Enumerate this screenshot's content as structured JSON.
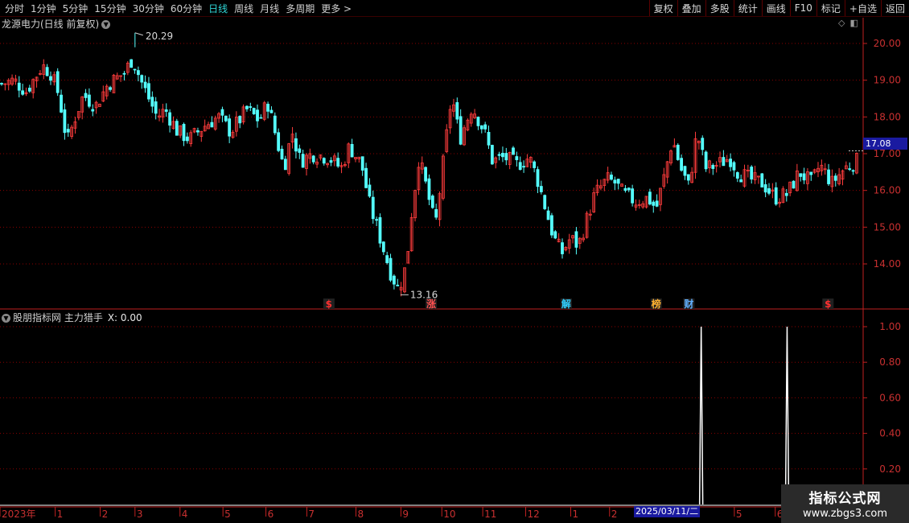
{
  "toolbar": {
    "periods": [
      "分时",
      "1分钟",
      "5分钟",
      "15分钟",
      "30分钟",
      "60分钟",
      "日线",
      "周线",
      "月线",
      "多周期",
      "更多 >"
    ],
    "active_period": "日线",
    "actions": [
      "复权",
      "叠加",
      "多股",
      "统计",
      "画线",
      "F10",
      "标记",
      "+自选",
      "返回"
    ]
  },
  "stock": {
    "title": "龙源电力(日线 前复权)",
    "current_price": "17.08",
    "high_label": "20.29",
    "low_label": "13.16"
  },
  "indicator": {
    "name": "股朋指标网 主力猎手",
    "value_label": "X: 0.00"
  },
  "date_cursor": "2025/03/11/二",
  "watermark": {
    "line1": "指标公式网",
    "line2": "www.zbgs3.com"
  },
  "colors": {
    "up": "#ff3c3c",
    "down": "#54ffff",
    "grid": "#8b0000",
    "axis": "#c02020",
    "indicator": "#ffffff"
  },
  "chart_data": [
    {
      "type": "candlestick",
      "title": "龙源电力(日线 前复权)",
      "ylim": [
        13.0,
        20.5
      ],
      "yticks": [
        14.0,
        15.0,
        16.0,
        17.0,
        18.0,
        19.0,
        20.0
      ],
      "ytick_labels": [
        "14.00",
        "15.00",
        "16.00",
        "17.00",
        "18.00",
        "19.00",
        "20.00"
      ],
      "annotations": {
        "max": 20.29,
        "min": 13.16,
        "last": 17.08
      },
      "event_markers": [
        {
          "label": "$",
          "month_index": 8.0
        },
        {
          "label": "涨",
          "month_index": 10.5
        },
        {
          "label": "解",
          "month_index": 13.8
        },
        {
          "label": "榜",
          "month_index": 16.0
        },
        {
          "label": "财",
          "month_index": 16.8
        },
        {
          "label": "$",
          "month_index": 20.2
        }
      ],
      "close_path": [
        [
          0,
          18.9
        ],
        [
          0.3,
          19.0
        ],
        [
          0.6,
          18.7
        ],
        [
          1.0,
          19.4
        ],
        [
          1.2,
          19.2
        ],
        [
          1.4,
          18.6
        ],
        [
          1.6,
          17.3
        ],
        [
          1.8,
          18.0
        ],
        [
          2.0,
          18.6
        ],
        [
          2.3,
          18.3
        ],
        [
          2.6,
          18.9
        ],
        [
          3.0,
          19.2
        ],
        [
          3.2,
          19.6
        ],
        [
          3.4,
          19.0
        ],
        [
          3.6,
          18.5
        ],
        [
          3.8,
          18.0
        ],
        [
          4.0,
          18.2
        ],
        [
          4.3,
          17.6
        ],
        [
          4.6,
          17.4
        ],
        [
          5.0,
          17.8
        ],
        [
          5.3,
          18.0
        ],
        [
          5.6,
          17.6
        ],
        [
          6.0,
          18.2
        ],
        [
          6.3,
          17.9
        ],
        [
          6.5,
          18.4
        ],
        [
          6.7,
          17.5
        ],
        [
          6.9,
          16.6
        ],
        [
          7.1,
          17.6
        ],
        [
          7.3,
          16.8
        ],
        [
          7.6,
          17.0
        ],
        [
          8.0,
          16.9
        ],
        [
          8.3,
          16.6
        ],
        [
          8.5,
          17.2
        ],
        [
          8.8,
          16.7
        ],
        [
          9.0,
          15.6
        ],
        [
          9.2,
          14.9
        ],
        [
          9.5,
          13.8
        ],
        [
          9.7,
          13.3
        ],
        [
          9.9,
          14.0
        ],
        [
          10.0,
          15.2
        ],
        [
          10.2,
          16.9
        ],
        [
          10.4,
          16.0
        ],
        [
          10.6,
          15.0
        ],
        [
          10.8,
          16.8
        ],
        [
          11.0,
          18.6
        ],
        [
          11.2,
          17.4
        ],
        [
          11.5,
          18.3
        ],
        [
          11.8,
          17.6
        ],
        [
          12.0,
          16.8
        ],
        [
          12.3,
          16.9
        ],
        [
          12.6,
          16.7
        ],
        [
          12.9,
          16.9
        ],
        [
          13.1,
          16.3
        ],
        [
          13.3,
          15.5
        ],
        [
          13.5,
          14.7
        ],
        [
          13.7,
          14.3
        ],
        [
          13.9,
          14.7
        ],
        [
          14.1,
          14.5
        ],
        [
          14.3,
          15.2
        ],
        [
          14.5,
          15.9
        ],
        [
          14.8,
          16.3
        ],
        [
          15.0,
          16.2
        ],
        [
          15.2,
          15.9
        ],
        [
          15.5,
          15.7
        ],
        [
          15.8,
          15.8
        ],
        [
          16.0,
          15.5
        ],
        [
          16.2,
          16.4
        ],
        [
          16.4,
          17.4
        ],
        [
          16.6,
          16.6
        ],
        [
          16.8,
          16.1
        ],
        [
          17.0,
          17.6
        ],
        [
          17.2,
          16.6
        ],
        [
          17.5,
          16.7
        ],
        [
          17.8,
          16.9
        ],
        [
          18.0,
          16.5
        ],
        [
          18.3,
          16.3
        ],
        [
          18.6,
          16.2
        ],
        [
          18.9,
          15.8
        ],
        [
          19.2,
          15.9
        ],
        [
          19.5,
          16.5
        ],
        [
          19.8,
          16.2
        ],
        [
          20.0,
          16.7
        ],
        [
          20.3,
          16.2
        ],
        [
          20.6,
          16.6
        ],
        [
          20.9,
          16.8
        ]
      ]
    },
    {
      "type": "line",
      "title": "股朋指标网 主力猎手",
      "ylim": [
        0,
        1.05
      ],
      "yticks": [
        0.2,
        0.4,
        0.6,
        0.8,
        1.0
      ],
      "ytick_labels": [
        "0.20",
        "0.40",
        "0.60",
        "0.80",
        "1.00"
      ],
      "spikes": [
        {
          "month_index": 17.1,
          "value": 1.0
        },
        {
          "month_index": 19.2,
          "value": 1.0
        }
      ],
      "baseline": 0.0
    }
  ],
  "x_axis": {
    "labels": [
      {
        "text": "2023年",
        "month_index": 0
      },
      {
        "text": "1",
        "month_index": 1.35
      },
      {
        "text": "2",
        "month_index": 2.45
      },
      {
        "text": "3",
        "month_index": 3.3
      },
      {
        "text": "4",
        "month_index": 4.4
      },
      {
        "text": "5",
        "month_index": 5.45
      },
      {
        "text": "6",
        "month_index": 6.5
      },
      {
        "text": "7",
        "month_index": 7.5
      },
      {
        "text": "8",
        "month_index": 8.7
      },
      {
        "text": "9",
        "month_index": 9.8
      },
      {
        "text": "10",
        "month_index": 10.8
      },
      {
        "text": "11",
        "month_index": 11.8
      },
      {
        "text": "12",
        "month_index": 12.85
      },
      {
        "text": "1",
        "month_index": 13.95
      },
      {
        "text": "2",
        "month_index": 14.9
      },
      {
        "text": "3",
        "month_index": 15.8
      },
      {
        "text": "5",
        "month_index": 17.95
      },
      {
        "text": "6",
        "month_index": 18.95
      }
    ]
  }
}
